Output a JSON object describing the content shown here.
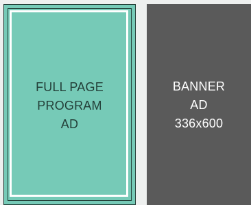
{
  "program_ad": {
    "lines": [
      "FULL PAGE",
      "PROGRAM",
      "AD"
    ],
    "background_color": "#76cab7",
    "text_color": "#233f38",
    "frame_color": "#ffffff",
    "border_color": "#1f3a33"
  },
  "banner_ad": {
    "lines": [
      "BANNER",
      "AD",
      "336x600"
    ],
    "background_color": "#5a5a5a",
    "text_color": "#ffffff"
  },
  "page_background": "#eef0ef"
}
